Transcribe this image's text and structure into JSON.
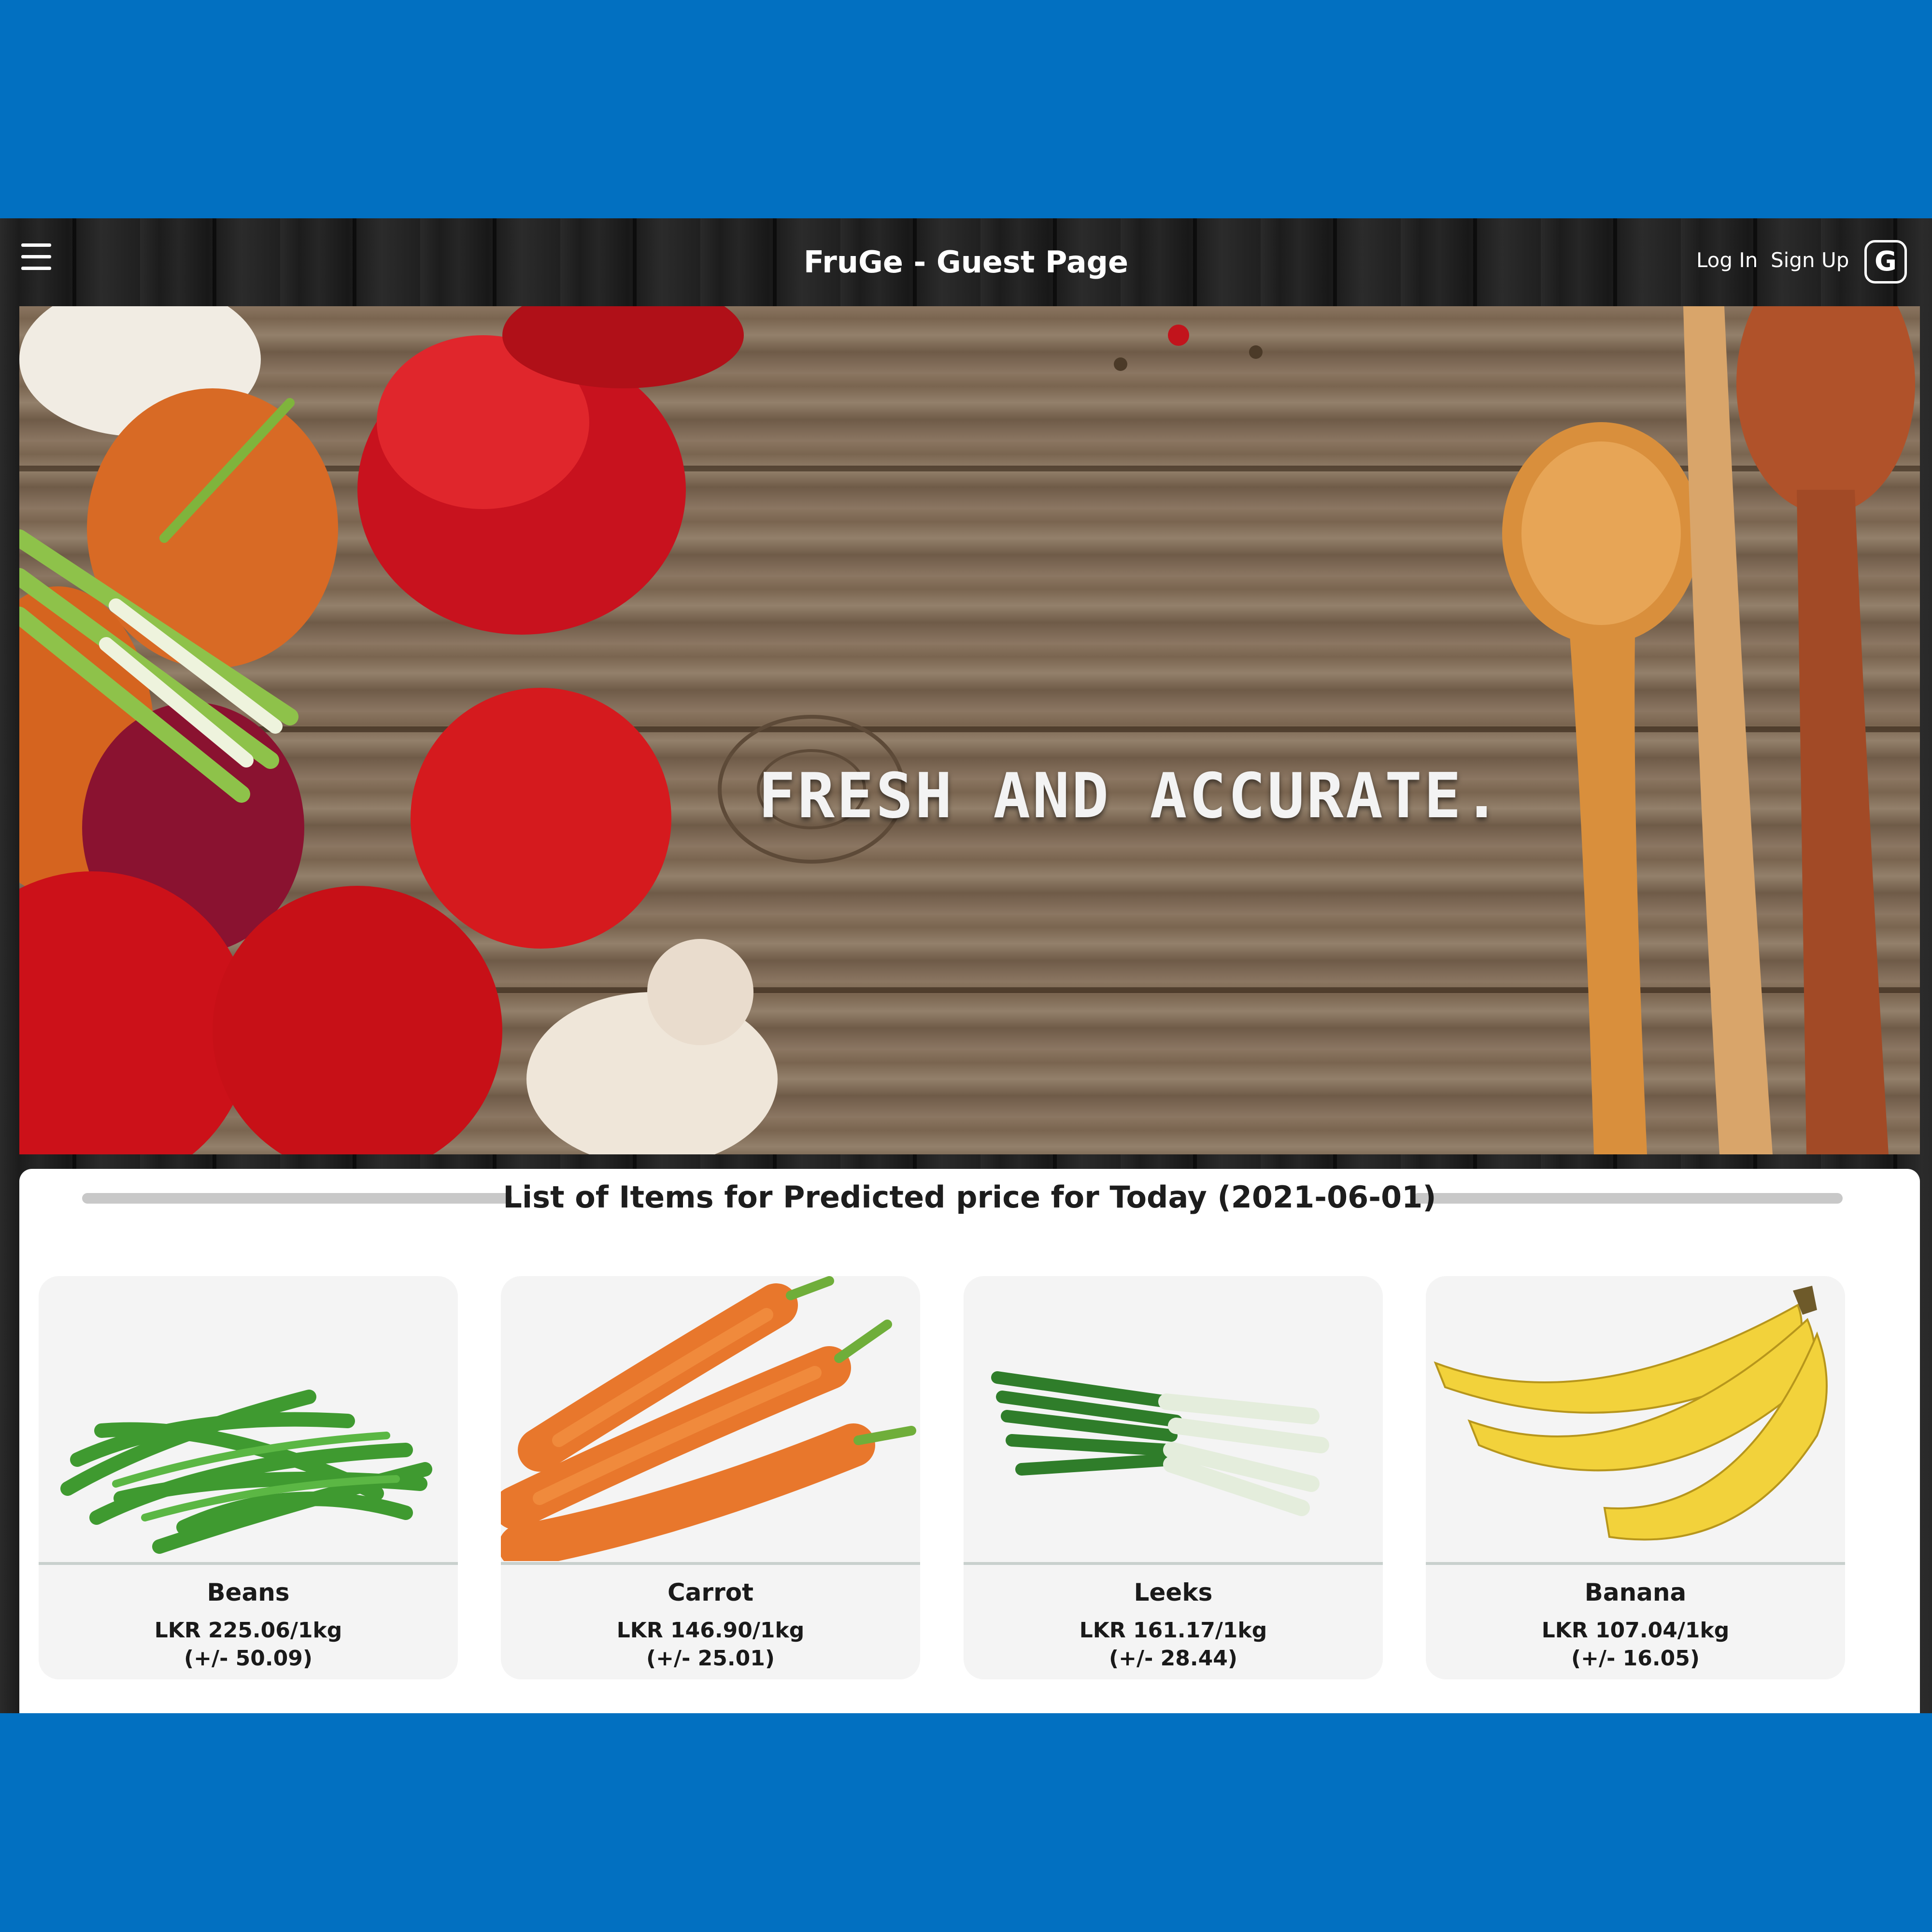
{
  "header": {
    "title": "FruGe - Guest Page",
    "login_label": "Log In",
    "signup_label": "Sign Up",
    "google_label": "G"
  },
  "hero": {
    "slogan": "FRESH AND ACCURATE."
  },
  "list": {
    "heading": "List of Items for Predicted price for Today (2021-06-01)",
    "items": [
      {
        "name": "Beans",
        "price": "LKR 225.06/1kg",
        "range": "(+/- 50.09)"
      },
      {
        "name": "Carrot",
        "price": "LKR 146.90/1kg",
        "range": "(+/- 25.01)"
      },
      {
        "name": "Leeks",
        "price": "LKR 161.17/1kg",
        "range": "(+/- 28.44)"
      },
      {
        "name": "Banana",
        "price": "LKR 107.04/1kg",
        "range": "(+/- 16.05)"
      }
    ]
  },
  "colors": {
    "page_background": "#0270c1",
    "header_text": "#ffffff",
    "card_background": "#f4f4f4"
  }
}
